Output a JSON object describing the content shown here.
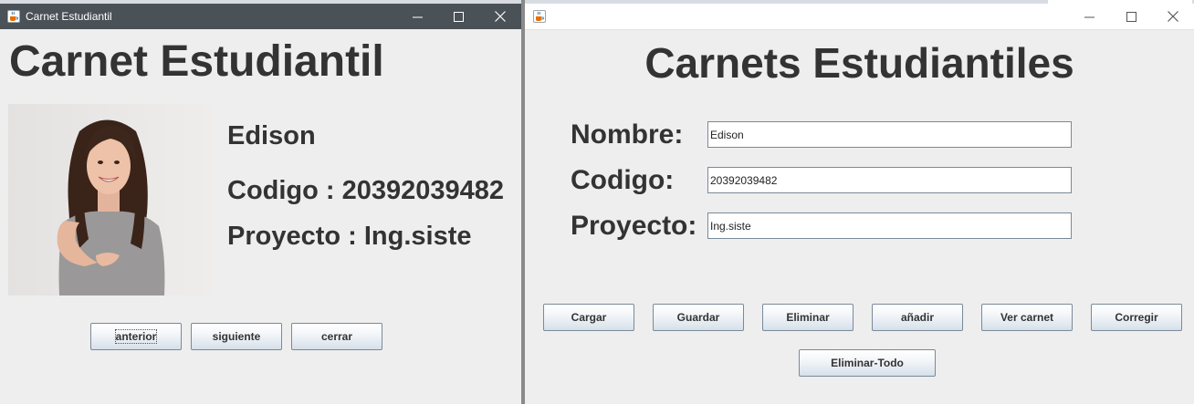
{
  "left_window": {
    "title": "Carnet Estudiantil",
    "heading": "Carnet Estudiantil",
    "name": "Edison",
    "codigo_line": "Codigo : 20392039482",
    "proyecto_line": "Proyecto : Ing.siste",
    "buttons": {
      "anterior": "anterior",
      "siguiente": "siguiente",
      "cerrar": "cerrar"
    }
  },
  "right_window": {
    "title": "",
    "heading": "Carnets Estudiantiles",
    "fields": {
      "nombre_label": "Nombre:",
      "nombre_value": "Edison",
      "codigo_label": "Codigo:",
      "codigo_value": "20392039482",
      "proyecto_label": "Proyecto:",
      "proyecto_value": "Ing.siste"
    },
    "buttons": {
      "cargar": "Cargar",
      "guardar": "Guardar",
      "eliminar": "Eliminar",
      "anadir": "añadir",
      "ver_carnet": "Ver carnet",
      "corregir": "Corregir",
      "eliminar_todo": "Eliminar-Todo"
    }
  },
  "icons": {
    "app": "java-coffee-icon",
    "minimize": "minimize-icon",
    "maximize": "maximize-icon",
    "close": "close-icon"
  },
  "colors": {
    "titlebar_active": "#4a5157",
    "titlebar_inactive": "#ffffff",
    "window_bg": "#eeeeee",
    "text": "#333333"
  }
}
